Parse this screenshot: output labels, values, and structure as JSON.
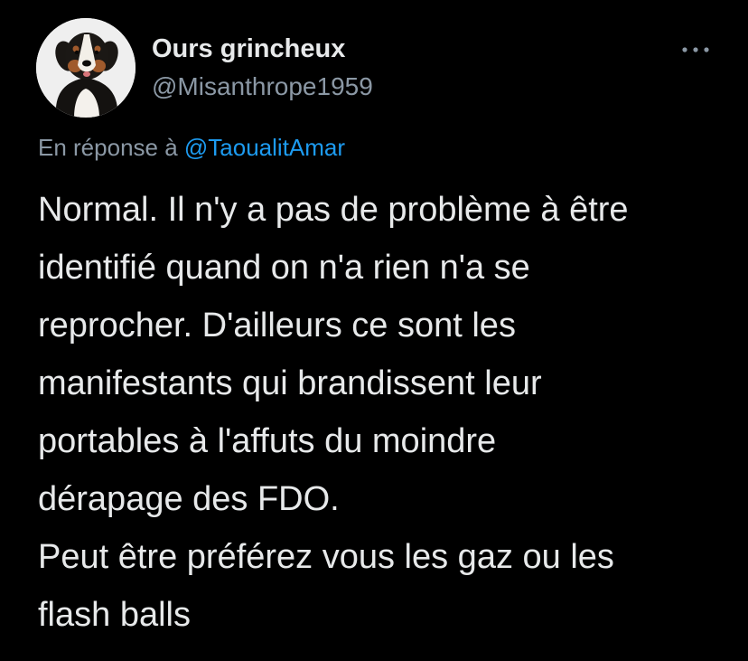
{
  "author": {
    "display_name": "Ours grincheux",
    "handle": "@Misanthrope1959",
    "avatar_icon": "bernese-mountain-dog-avatar"
  },
  "reply_context": {
    "prefix": "En réponse à",
    "mention": "@TaoualitAmar"
  },
  "tweet": {
    "text_lines": [
      "Normal. Il n'y a pas de problème à être",
      "identifié quand on n'a rien n'a se",
      "reprocher. D'ailleurs ce sont les",
      "manifestants qui brandissent leur",
      "portables à l'affuts du moindre",
      "dérapage des FDO.",
      "Peut être préférez vous les gaz ou les",
      "flash balls"
    ]
  },
  "menu": {
    "icon": "more-horizontal-icon"
  },
  "colors": {
    "background": "#000000",
    "primary_text": "#e7e9ea",
    "secondary_text": "#8b98a5",
    "link": "#1d9bf0"
  }
}
